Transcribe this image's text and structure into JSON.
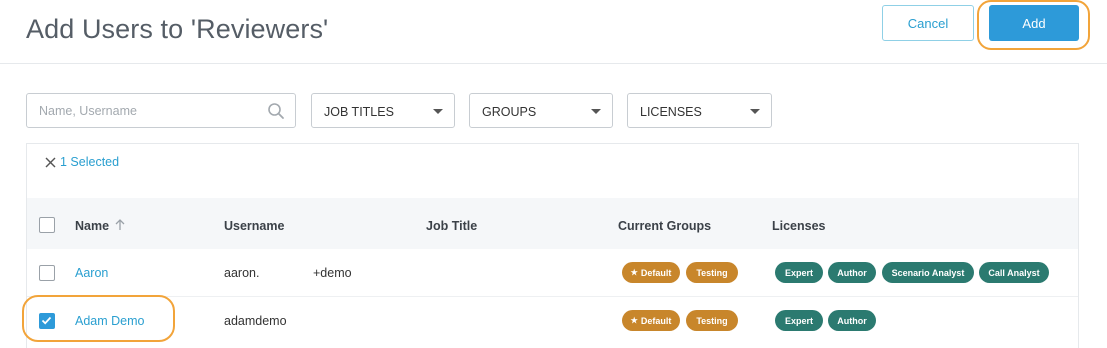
{
  "header": {
    "title": "Add Users to 'Reviewers'",
    "cancel_label": "Cancel",
    "add_label": "Add"
  },
  "filters": {
    "search_placeholder": "Name, Username",
    "job_titles": "JOB TITLES",
    "groups": "GROUPS",
    "licenses": "LICENSES"
  },
  "selection": {
    "label": "1 Selected"
  },
  "table": {
    "columns": [
      "Name",
      "Username",
      "Job Title",
      "Current Groups",
      "Licenses"
    ],
    "rows": [
      {
        "name": "Aaron",
        "username_left": "aaron.",
        "username_right": "+demo",
        "job_title": "",
        "groups": [
          "Default",
          "Testing"
        ],
        "licenses": [
          "Expert",
          "Author",
          "Scenario Analyst",
          "Call Analyst"
        ],
        "checked": false
      },
      {
        "name": "Adam Demo",
        "username": "adamdemo",
        "job_title": "",
        "groups": [
          "Default",
          "Testing"
        ],
        "licenses": [
          "Expert",
          "Author"
        ],
        "checked": true
      }
    ]
  },
  "icons": {
    "search": "search-icon",
    "caret": "caret-down-icon",
    "clear": "close-icon",
    "sort": "sort-up-arrow-icon",
    "check": "checkmark-icon",
    "default_group": "star-icon"
  },
  "colors": {
    "accent": "#2d9ad9",
    "highlight": "#f2a43a",
    "group_badge": "#c8862b",
    "license_badge": "#2b7a70"
  }
}
